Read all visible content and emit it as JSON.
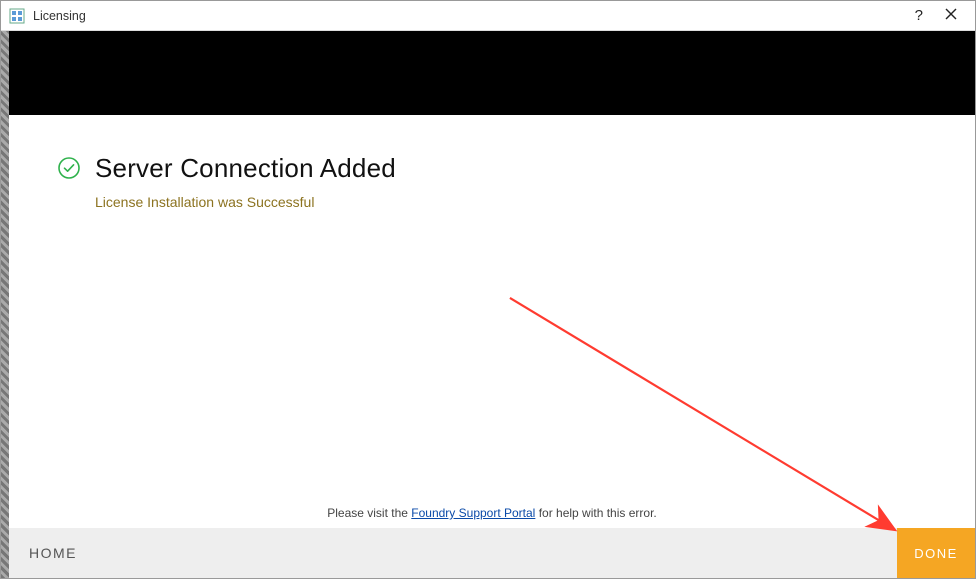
{
  "window": {
    "title": "Licensing",
    "help_symbol": "?",
    "close_symbol": "×"
  },
  "status": {
    "title": "Server Connection Added",
    "subtitle": "License Installation was Successful"
  },
  "help_line": {
    "prefix": "Please visit the ",
    "link_text": "Foundry Support Portal",
    "suffix": " for help with this error."
  },
  "footer": {
    "home_label": "HOME",
    "done_label": "DONE"
  },
  "colors": {
    "accent": "#f5a623",
    "success": "#2fb24c",
    "subtitle": "#8c7320",
    "link": "#0a4aa8"
  }
}
